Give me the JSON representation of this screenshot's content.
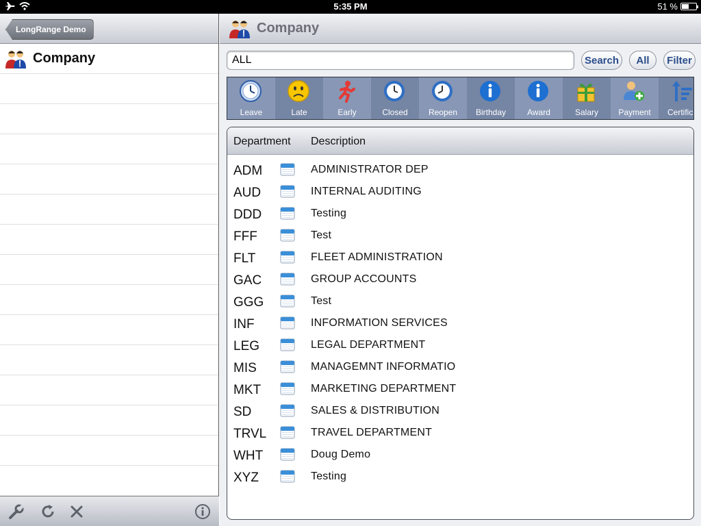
{
  "status_bar": {
    "time": "5:35 PM",
    "battery": "51 %",
    "battery_level": 0.51
  },
  "left_panel": {
    "back_label": "LongRange Demo",
    "title": "Company"
  },
  "right_panel": {
    "title": "Company",
    "search": {
      "value": "ALL",
      "placeholder": ""
    },
    "buttons": {
      "search": "Search",
      "all": "All",
      "filter": "Filter"
    },
    "categories": [
      {
        "label": "Leave",
        "icon": "clock-blue-icon"
      },
      {
        "label": "Late",
        "icon": "sad-face-icon"
      },
      {
        "label": "Early",
        "icon": "running-man-icon"
      },
      {
        "label": "Closed",
        "icon": "clock-icon"
      },
      {
        "label": "Reopen",
        "icon": "clock-icon"
      },
      {
        "label": "Birthday",
        "icon": "info-icon"
      },
      {
        "label": "Award",
        "icon": "info-icon"
      },
      {
        "label": "Salary",
        "icon": "gift-icon"
      },
      {
        "label": "Payment",
        "icon": "user-add-icon"
      },
      {
        "label": "Certifica",
        "icon": "sort-icon"
      }
    ],
    "table": {
      "headers": {
        "department": "Department",
        "description": "Description"
      },
      "rows": [
        {
          "code": "ADM",
          "desc": "ADMINISTRATOR DEP"
        },
        {
          "code": "AUD",
          "desc": "INTERNAL AUDITING"
        },
        {
          "code": "DDD",
          "desc": "Testing"
        },
        {
          "code": "FFF",
          "desc": "Test"
        },
        {
          "code": "FLT",
          "desc": "FLEET ADMINISTRATION"
        },
        {
          "code": "GAC",
          "desc": "GROUP ACCOUNTS"
        },
        {
          "code": "GGG",
          "desc": "Test"
        },
        {
          "code": "INF",
          "desc": "INFORMATION SERVICES"
        },
        {
          "code": "LEG",
          "desc": "LEGAL DEPARTMENT"
        },
        {
          "code": "MIS",
          "desc": "MANAGEMNT INFORMATIO"
        },
        {
          "code": "MKT",
          "desc": "MARKETING DEPARTMENT"
        },
        {
          "code": "SD",
          "desc": "SALES & DISTRIBUTION"
        },
        {
          "code": "TRVL",
          "desc": "TRAVEL DEPARTMENT"
        },
        {
          "code": "WHT",
          "desc": "Doug Demo"
        },
        {
          "code": "XYZ",
          "desc": "Testing"
        }
      ]
    }
  }
}
